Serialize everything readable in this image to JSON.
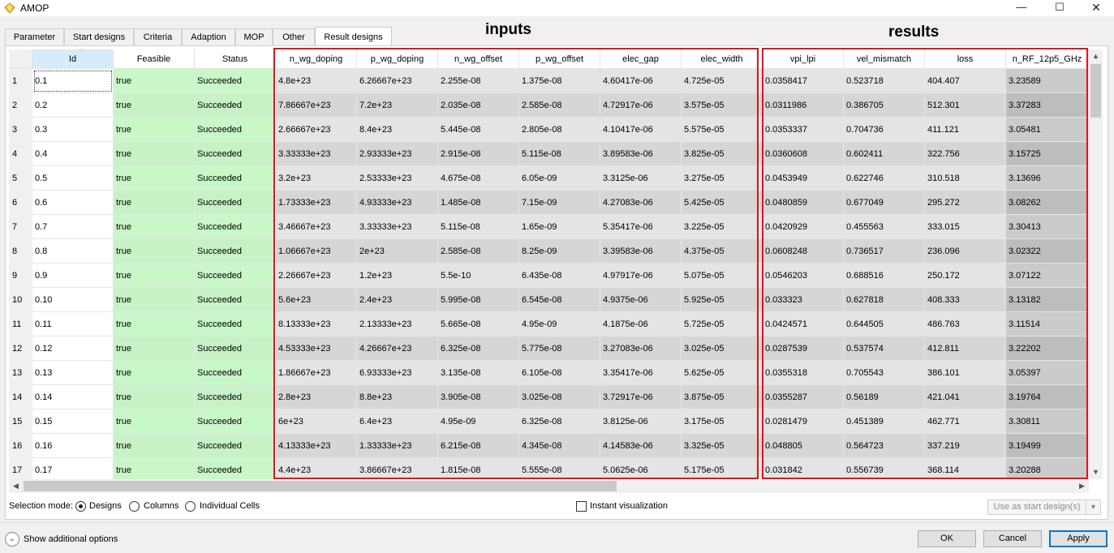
{
  "window": {
    "title": "AMOP",
    "minimize": "—",
    "maximize": "☐",
    "close": "✕"
  },
  "tabs": [
    {
      "label": "Parameter"
    },
    {
      "label": "Start designs"
    },
    {
      "label": "Criteria"
    },
    {
      "label": "Adaption"
    },
    {
      "label": "MOP"
    },
    {
      "label": "Other"
    },
    {
      "label": "Result designs",
      "active": true
    }
  ],
  "annotations": {
    "inputs": "inputs",
    "results": "results",
    "box_color": "#e0141e"
  },
  "table": {
    "columns": [
      "Id",
      "Feasible",
      "Status",
      "n_wg_doping",
      "p_wg_doping",
      "n_wg_offset",
      "p_wg_offset",
      "elec_gap",
      "elec_width",
      "vpi_lpi",
      "vel_mismatch",
      "loss",
      "n_RF_12p5_GHz"
    ],
    "sorted_column": "Id",
    "rows": [
      [
        "1",
        "0.1",
        "true",
        "Succeeded",
        "4.8e+23",
        "6.26667e+23",
        "2.255e-08",
        "1.375e-08",
        "4.60417e-06",
        "4.725e-05",
        "0.0358417",
        "0.523718",
        "404.407",
        "3.23589"
      ],
      [
        "2",
        "0.2",
        "true",
        "Succeeded",
        "7.86667e+23",
        "7.2e+23",
        "2.035e-08",
        "2.585e-08",
        "4.72917e-06",
        "3.575e-05",
        "0.0311986",
        "0.386705",
        "512.301",
        "3.37283"
      ],
      [
        "3",
        "0.3",
        "true",
        "Succeeded",
        "2.66667e+23",
        "8.4e+23",
        "5.445e-08",
        "2.805e-08",
        "4.10417e-06",
        "5.575e-05",
        "0.0353337",
        "0.704736",
        "411.121",
        "3.05481"
      ],
      [
        "4",
        "0.4",
        "true",
        "Succeeded",
        "3.33333e+23",
        "2.93333e+23",
        "2.915e-08",
        "5.115e-08",
        "3.89583e-06",
        "3.825e-05",
        "0.0360608",
        "0.602411",
        "322.756",
        "3.15725"
      ],
      [
        "5",
        "0.5",
        "true",
        "Succeeded",
        "3.2e+23",
        "2.53333e+23",
        "4.675e-08",
        "6.05e-09",
        "3.3125e-06",
        "3.275e-05",
        "0.0453949",
        "0.622746",
        "310.518",
        "3.13696"
      ],
      [
        "6",
        "0.6",
        "true",
        "Succeeded",
        "1.73333e+23",
        "4.93333e+23",
        "1.485e-08",
        "7.15e-09",
        "4.27083e-06",
        "5.425e-05",
        "0.0480859",
        "0.677049",
        "295.272",
        "3.08262"
      ],
      [
        "7",
        "0.7",
        "true",
        "Succeeded",
        "3.46667e+23",
        "3.33333e+23",
        "5.115e-08",
        "1.65e-09",
        "5.35417e-06",
        "3.225e-05",
        "0.0420929",
        "0.455563",
        "333.015",
        "3.30413"
      ],
      [
        "8",
        "0.8",
        "true",
        "Succeeded",
        "1.06667e+23",
        "2e+23",
        "2.585e-08",
        "8.25e-09",
        "3.39583e-06",
        "4.375e-05",
        "0.0608248",
        "0.736517",
        "236.096",
        "3.02322"
      ],
      [
        "9",
        "0.9",
        "true",
        "Succeeded",
        "2.26667e+23",
        "1.2e+23",
        "5.5e-10",
        "6.435e-08",
        "4.97917e-06",
        "5.075e-05",
        "0.0546203",
        "0.688516",
        "250.172",
        "3.07122"
      ],
      [
        "10",
        "0.10",
        "true",
        "Succeeded",
        "5.6e+23",
        "2.4e+23",
        "5.995e-08",
        "6.545e-08",
        "4.9375e-06",
        "5.925e-05",
        "0.033323",
        "0.627818",
        "408.333",
        "3.13182"
      ],
      [
        "11",
        "0.11",
        "true",
        "Succeeded",
        "8.13333e+23",
        "2.13333e+23",
        "5.665e-08",
        "4.95e-09",
        "4.1875e-06",
        "5.725e-05",
        "0.0424571",
        "0.644505",
        "486.763",
        "3.11514"
      ],
      [
        "12",
        "0.12",
        "true",
        "Succeeded",
        "4.53333e+23",
        "4.26667e+23",
        "6.325e-08",
        "5.775e-08",
        "3.27083e-06",
        "3.025e-05",
        "0.0287539",
        "0.537574",
        "412.811",
        "3.22202"
      ],
      [
        "13",
        "0.13",
        "true",
        "Succeeded",
        "1.86667e+23",
        "6.93333e+23",
        "3.135e-08",
        "6.105e-08",
        "3.35417e-06",
        "5.625e-05",
        "0.0355318",
        "0.705543",
        "386.101",
        "3.05397"
      ],
      [
        "14",
        "0.14",
        "true",
        "Succeeded",
        "2.8e+23",
        "8.8e+23",
        "3.905e-08",
        "3.025e-08",
        "3.72917e-06",
        "3.875e-05",
        "0.0355287",
        "0.56189",
        "421.041",
        "3.19764"
      ],
      [
        "15",
        "0.15",
        "true",
        "Succeeded",
        "6e+23",
        "6.4e+23",
        "4.95e-09",
        "6.325e-08",
        "3.8125e-06",
        "3.175e-05",
        "0.0281479",
        "0.451389",
        "462.771",
        "3.30811"
      ],
      [
        "16",
        "0.16",
        "true",
        "Succeeded",
        "4.13333e+23",
        "1.33333e+23",
        "6.215e-08",
        "4.345e-08",
        "4.14583e-06",
        "3.325e-05",
        "0.048805",
        "0.564723",
        "337.219",
        "3.19499"
      ],
      [
        "17",
        "0.17",
        "true",
        "Succeeded",
        "4.4e+23",
        "3.86667e+23",
        "1.815e-08",
        "5.555e-08",
        "5.0625e-06",
        "5.175e-05",
        "0.031842",
        "0.556739",
        "368.114",
        "3.20288"
      ]
    ]
  },
  "selection_mode": {
    "label": "Selection mode:",
    "options": [
      {
        "label": "Designs",
        "checked": true
      },
      {
        "label": "Columns",
        "checked": false
      },
      {
        "label": "Individual Cells",
        "checked": false
      }
    ]
  },
  "instant_visualization": {
    "label": "Instant visualization",
    "checked": false
  },
  "use_start": {
    "label": "Use as start design(s)",
    "enabled": false
  },
  "footer": {
    "show_additional": "Show additional options",
    "ok": "OK",
    "cancel": "Cancel",
    "apply": "Apply"
  }
}
